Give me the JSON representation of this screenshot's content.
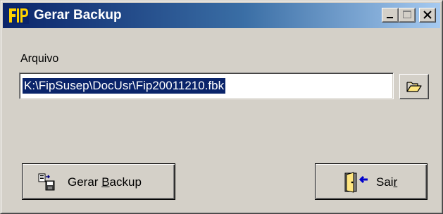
{
  "window": {
    "title": "Gerar Backup",
    "logo_icon": "fip-logo-icon",
    "controls": {
      "minimize_icon": "minimize-icon",
      "maximize_icon": "maximize-icon",
      "close_icon": "close-icon"
    },
    "colors": {
      "titlebar_start": "#0a246a",
      "titlebar_end": "#a6caf0",
      "face": "#d4d0c8",
      "selection": "#0a246a"
    }
  },
  "form": {
    "file_label": "Arquivo",
    "file_value": "K:\\FipSusep\\DocUsr\\Fip20011210.fbk",
    "browse_icon": "folder-open-icon"
  },
  "buttons": {
    "backup": {
      "label_pre": "Gerar ",
      "label_mnemonic": "B",
      "label_post": "ackup",
      "icon": "backup-disk-icon"
    },
    "exit": {
      "label_pre": "Sai",
      "label_mnemonic": "r",
      "label_post": "",
      "icon": "exit-door-icon"
    }
  }
}
